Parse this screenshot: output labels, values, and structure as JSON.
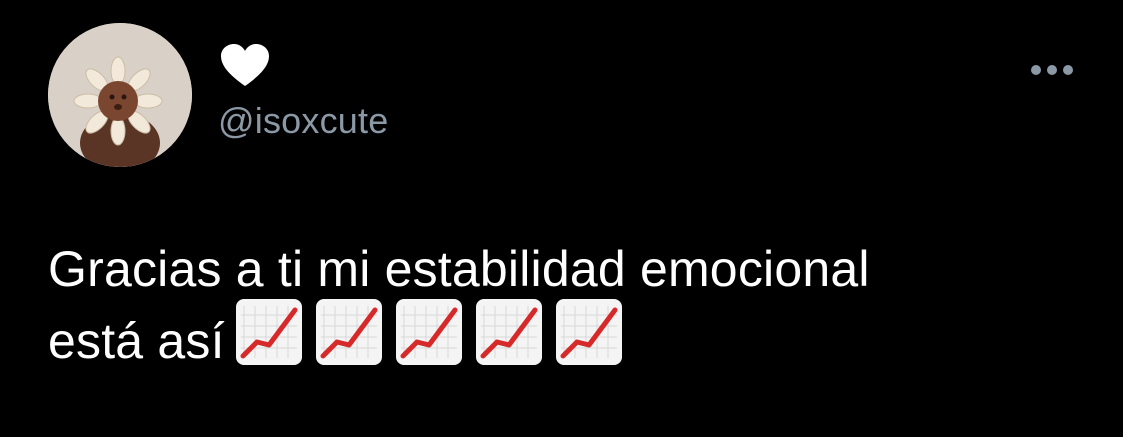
{
  "tweet": {
    "display_name_icon": "white-heart-icon",
    "handle": "@isoxcute",
    "text_line_1": "Gracias a ti mi estabilidad emocional",
    "text_line_2": "está así",
    "emoji_icon": "chart-increasing-icon",
    "emoji_count": 5,
    "more_icon": "more-horizontal-icon"
  },
  "colors": {
    "background": "#000000",
    "text": "#ffffff",
    "handle": "#8b98a5",
    "emoji_line": "#d62a2a"
  }
}
